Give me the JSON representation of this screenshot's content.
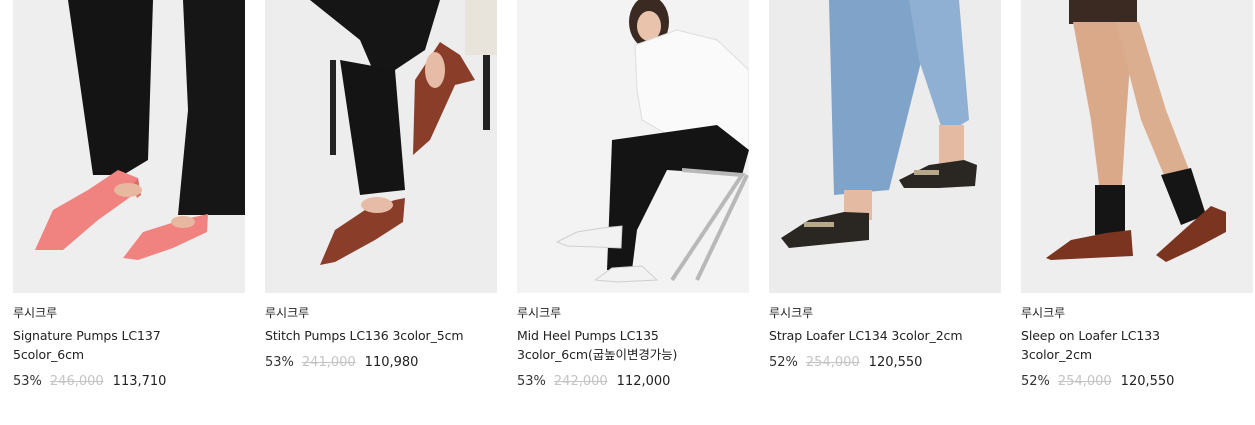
{
  "products": [
    {
      "brand": "루시크루",
      "name_line1": "Signature Pumps LC137",
      "name_line2": "5color_6cm",
      "discount": "53%",
      "original_price": "246,000",
      "sale_price": "113,710",
      "shoe_color": "#f0827f"
    },
    {
      "brand": "루시크루",
      "name_line1": "Stitch Pumps LC136 3color_5cm",
      "name_line2": "",
      "discount": "53%",
      "original_price": "241,000",
      "sale_price": "110,980",
      "shoe_color": "#8a3e2a"
    },
    {
      "brand": "루시크루",
      "name_line1": "Mid Heel Pumps LC135",
      "name_line2": "3color_6cm(굽높이변경가능)",
      "discount": "53%",
      "original_price": "242,000",
      "sale_price": "112,000",
      "shoe_color": "#f2f2f2"
    },
    {
      "brand": "루시크루",
      "name_line1": "Strap Loafer LC134 3color_2cm",
      "name_line2": "",
      "discount": "52%",
      "original_price": "254,000",
      "sale_price": "120,550",
      "shoe_color": "#2a2622"
    },
    {
      "brand": "루시크루",
      "name_line1": "Sleep on Loafer LC133",
      "name_line2": "3color_2cm",
      "discount": "52%",
      "original_price": "254,000",
      "sale_price": "120,550",
      "shoe_color": "#7a3420"
    }
  ]
}
